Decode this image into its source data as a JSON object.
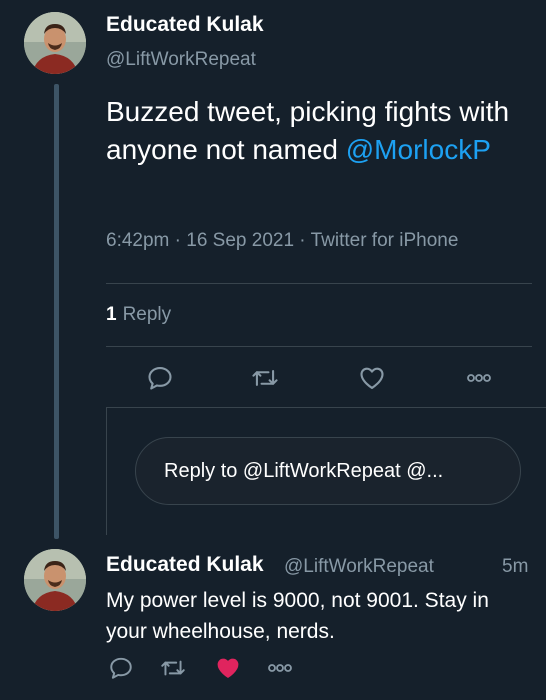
{
  "tweet": {
    "author_name": "Educated Kulak",
    "author_handle": "@LiftWorkRepeat",
    "text_before_mention": "Buzzed tweet, picking fights with anyone not named ",
    "mention": "@MorlockP",
    "meta": "6:42pm · 16 Sep 2021 · Twitter for iPhone",
    "reply_count": "1",
    "reply_label": "Reply"
  },
  "actions": {
    "icons": [
      "reply-icon",
      "retweet-icon",
      "like-icon",
      "more-icon"
    ],
    "liked_color": "#e0245e"
  },
  "composer": {
    "placeholder": "Reply to @LiftWorkRepeat @..."
  },
  "reply": {
    "author_name": "Educated Kulak",
    "author_handle": "@LiftWorkRepeat",
    "time": "5m",
    "text": "My power level is 9000, not 9001. Stay in your wheelhouse, nerds.",
    "liked": true
  },
  "colors": {
    "background": "#15202b",
    "accent": "#1da1f2",
    "muted": "#8899a6"
  }
}
